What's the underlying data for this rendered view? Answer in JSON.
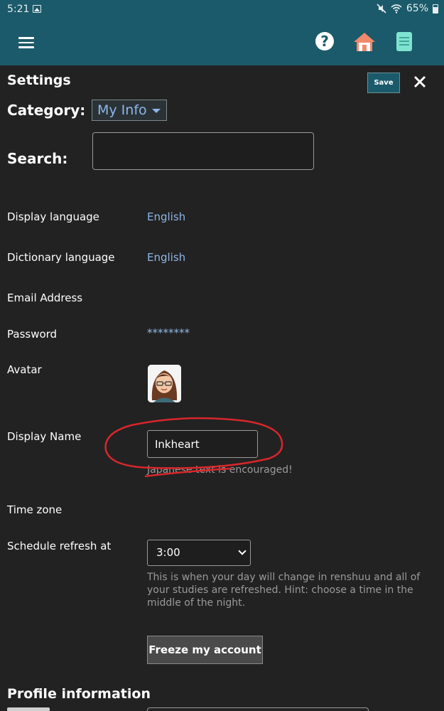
{
  "status_bar": {
    "time": "5:21",
    "battery": "65%"
  },
  "settings": {
    "title": "Settings",
    "save_label": "Save",
    "category_label": "Category:",
    "category_value": "My Info",
    "search_label": "Search:",
    "search_value": ""
  },
  "rows": {
    "display_language": {
      "label": "Display language",
      "value": "English"
    },
    "dictionary_language": {
      "label": "Dictionary language",
      "value": "English"
    },
    "email": {
      "label": "Email Address"
    },
    "password": {
      "label": "Password",
      "value": "********"
    },
    "avatar": {
      "label": "Avatar"
    },
    "display_name": {
      "label": "Display Name",
      "value": "Inkheart",
      "hint": "Japanese text is encouraged!"
    },
    "time_zone": {
      "label": "Time zone"
    },
    "schedule": {
      "label": "Schedule refresh at",
      "value": "3:00",
      "hint": "This is when your day will change in renshuu and all of your studies are refreshed. Hint: choose a time in the middle of the night."
    }
  },
  "freeze_label": "Freeze my account",
  "profile_section_title": "Profile information",
  "colors": {
    "appbar": "#1b5a6a",
    "background": "#222222",
    "link": "#8fb6e8",
    "annotation": "#d9262b"
  }
}
